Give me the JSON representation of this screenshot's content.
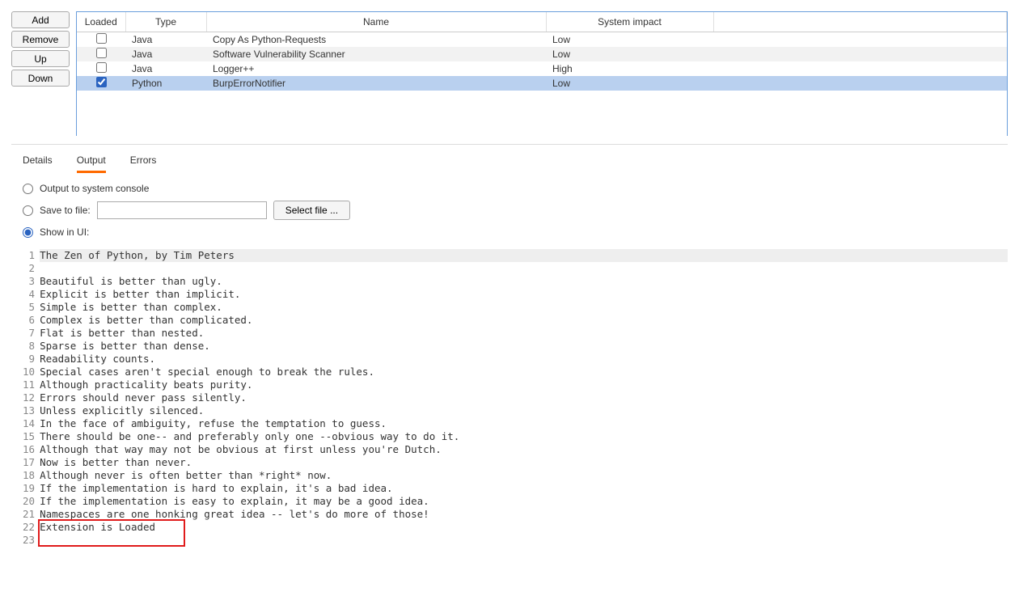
{
  "sideButtons": {
    "add": "Add",
    "remove": "Remove",
    "up": "Up",
    "down": "Down"
  },
  "table": {
    "headers": {
      "loaded": "Loaded",
      "type": "Type",
      "name": "Name",
      "impact": "System impact"
    },
    "rows": [
      {
        "loaded": false,
        "type": "Java",
        "name": "Copy As Python-Requests",
        "impact": "Low",
        "selected": false
      },
      {
        "loaded": false,
        "type": "Java",
        "name": "Software Vulnerability Scanner",
        "impact": "Low",
        "selected": false
      },
      {
        "loaded": false,
        "type": "Java",
        "name": "Logger++",
        "impact": "High",
        "selected": false
      },
      {
        "loaded": true,
        "type": "Python",
        "name": "BurpErrorNotifier",
        "impact": "Low",
        "selected": true
      }
    ]
  },
  "tabs": {
    "details": "Details",
    "output": "Output",
    "errors": "Errors",
    "active": "output"
  },
  "outputOptions": {
    "console": "Output to system console",
    "save": "Save to file:",
    "selectFile": "Select file ...",
    "showInUi": "Show in UI:",
    "filePath": "",
    "selected": "showInUi"
  },
  "codeLines": [
    "The Zen of Python, by Tim Peters",
    "",
    "Beautiful is better than ugly.",
    "Explicit is better than implicit.",
    "Simple is better than complex.",
    "Complex is better than complicated.",
    "Flat is better than nested.",
    "Sparse is better than dense.",
    "Readability counts.",
    "Special cases aren't special enough to break the rules.",
    "Although practicality beats purity.",
    "Errors should never pass silently.",
    "Unless explicitly silenced.",
    "In the face of ambiguity, refuse the temptation to guess.",
    "There should be one-- and preferably only one --obvious way to do it.",
    "Although that way may not be obvious at first unless you're Dutch.",
    "Now is better than never.",
    "Although never is often better than *right* now.",
    "If the implementation is hard to explain, it's a bad idea.",
    "If the implementation is easy to explain, it may be a good idea.",
    "Namespaces are one honking great idea -- let's do more of those!",
    "Extension is Loaded",
    ""
  ],
  "highlight": {
    "startLine": 22,
    "endLine": 23,
    "widthCh": 24
  }
}
